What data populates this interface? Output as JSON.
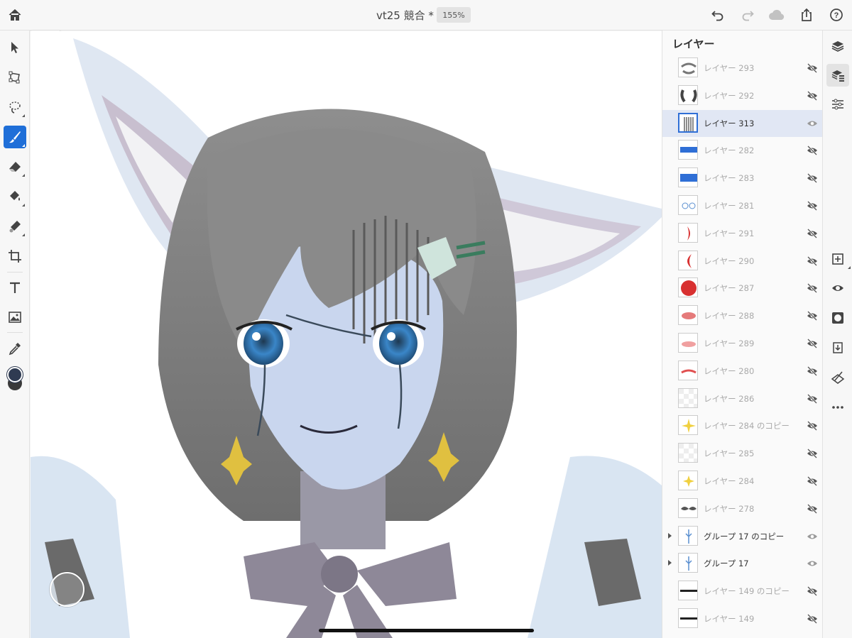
{
  "header": {
    "title": "vt25 競合 *",
    "zoom": "155%",
    "icons": [
      "home-icon",
      "undo-icon",
      "redo-icon",
      "cloud-icon",
      "share-icon",
      "help-icon"
    ]
  },
  "toolbar": {
    "tools": [
      "select-tool",
      "transform-tool",
      "lasso-tool",
      "brush-tool",
      "eraser-tool",
      "fill-tool",
      "smudge-tool",
      "crop-tool",
      "text-tool",
      "image-tool",
      "eyedropper-tool",
      "color-swatch"
    ],
    "active": "brush-tool"
  },
  "brush_flyout": {
    "size": "5",
    "more": "•••"
  },
  "colors": {
    "accent": "#1f6fd8",
    "primary": "#2f3b52",
    "secondary": "#3a3a3a",
    "swatch_square": "#2f3b52",
    "swatch_circle": "#666666"
  },
  "layers_panel": {
    "title": "レイヤー",
    "layers": [
      {
        "name": "レイヤー 293",
        "visible": false,
        "selected": false,
        "group": false
      },
      {
        "name": "レイヤー 292",
        "visible": false,
        "selected": false,
        "group": false
      },
      {
        "name": "レイヤー 313",
        "visible": true,
        "selected": true,
        "group": false
      },
      {
        "name": "レイヤー 282",
        "visible": false,
        "selected": false,
        "group": false
      },
      {
        "name": "レイヤー 283",
        "visible": false,
        "selected": false,
        "group": false
      },
      {
        "name": "レイヤー 281",
        "visible": false,
        "selected": false,
        "group": false
      },
      {
        "name": "レイヤー 291",
        "visible": false,
        "selected": false,
        "group": false
      },
      {
        "name": "レイヤー 290",
        "visible": false,
        "selected": false,
        "group": false
      },
      {
        "name": "レイヤー 287",
        "visible": false,
        "selected": false,
        "group": false
      },
      {
        "name": "レイヤー 288",
        "visible": false,
        "selected": false,
        "group": false
      },
      {
        "name": "レイヤー 289",
        "visible": false,
        "selected": false,
        "group": false
      },
      {
        "name": "レイヤー 280",
        "visible": false,
        "selected": false,
        "group": false
      },
      {
        "name": "レイヤー 286",
        "visible": false,
        "selected": false,
        "group": false
      },
      {
        "name": "レイヤー 284 のコピー",
        "visible": false,
        "selected": false,
        "group": false
      },
      {
        "name": "レイヤー 285",
        "visible": false,
        "selected": false,
        "group": false
      },
      {
        "name": "レイヤー 284",
        "visible": false,
        "selected": false,
        "group": false
      },
      {
        "name": "レイヤー 278",
        "visible": false,
        "selected": false,
        "group": false
      },
      {
        "name": "グループ 17 のコピー",
        "visible": true,
        "selected": false,
        "group": true
      },
      {
        "name": "グループ 17",
        "visible": true,
        "selected": false,
        "group": true
      },
      {
        "name": "レイヤー 149 のコピー",
        "visible": false,
        "selected": false,
        "group": false
      },
      {
        "name": "レイヤー 149",
        "visible": false,
        "selected": false,
        "group": false
      }
    ]
  },
  "right_bar": {
    "tools": [
      "layers-icon",
      "layer-properties-icon",
      "adjustments-icon",
      "add-layer-icon",
      "visibility-icon",
      "mask-icon",
      "merge-down-icon",
      "clear-layer-icon",
      "more-icon"
    ]
  }
}
